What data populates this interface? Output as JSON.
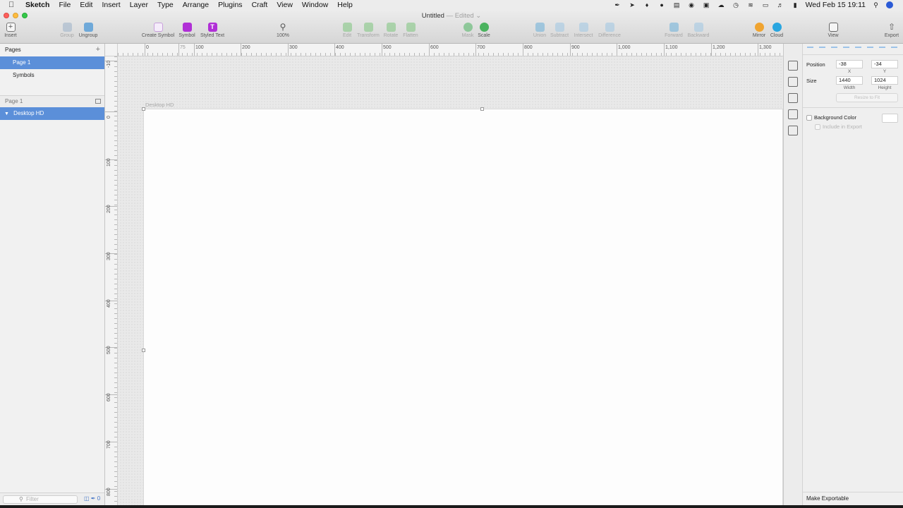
{
  "menubar": {
    "app_name": "Sketch",
    "items": [
      "File",
      "Edit",
      "Insert",
      "Layer",
      "Type",
      "Arrange",
      "Plugins",
      "Craft",
      "View",
      "Window",
      "Help"
    ],
    "clock": "Wed Feb 15  19:11"
  },
  "window": {
    "title": "Untitled",
    "status": "— Edited ⌄"
  },
  "toolbar": {
    "insert": "Insert",
    "group": "Group",
    "ungroup": "Ungroup",
    "create_symbol": "Create Symbol",
    "symbol": "Symbol",
    "styled_text": "Styled Text",
    "zoom": "100%",
    "edit": "Edit",
    "transform": "Transform",
    "rotate": "Rotate",
    "flatten": "Flatten",
    "mask": "Mask",
    "scale": "Scale",
    "union": "Union",
    "subtract": "Subtract",
    "intersect": "Intersect",
    "difference": "Difference",
    "forward": "Forward",
    "backward": "Backward",
    "mirror": "Mirror",
    "cloud": "Cloud",
    "view": "View",
    "export": "Export"
  },
  "pages_panel": {
    "header": "Pages",
    "pages": [
      "Page 1",
      "Symbols"
    ],
    "selected_page": "Page 1"
  },
  "layers_panel": {
    "header": "Page 1",
    "layers": [
      "Desktop HD"
    ],
    "filter_placeholder": "Filter",
    "badge_count": "0"
  },
  "canvas": {
    "ruler_h_labels": [
      "0",
      "75",
      "100",
      "200",
      "300",
      "400",
      "500",
      "600",
      "700",
      "800",
      "900",
      "1,000",
      "1,100",
      "1,200",
      "1,300"
    ],
    "ruler_v_labels": [
      "-10",
      "0",
      "100",
      "200",
      "300",
      "400",
      "500",
      "600",
      "700",
      "800"
    ],
    "artboard_name": "Desktop HD"
  },
  "inspector": {
    "position_label": "Position",
    "x_value": "-38",
    "y_value": "-34",
    "x_label": "X",
    "y_label": "Y",
    "size_label": "Size",
    "width_value": "1440",
    "height_value": "1024",
    "width_label": "Width",
    "height_label": "Height",
    "resize_to_fit": "Resize to Fit",
    "background_color_label": "Background Color",
    "include_in_export_label": "Include in Export",
    "make_exportable": "Make Exportable"
  },
  "colors": {
    "selection": "#5b8fd9",
    "symbol_accent": "#b02fd6",
    "cloud_accent": "#29a6e0",
    "mirror_accent": "#f0a430"
  }
}
